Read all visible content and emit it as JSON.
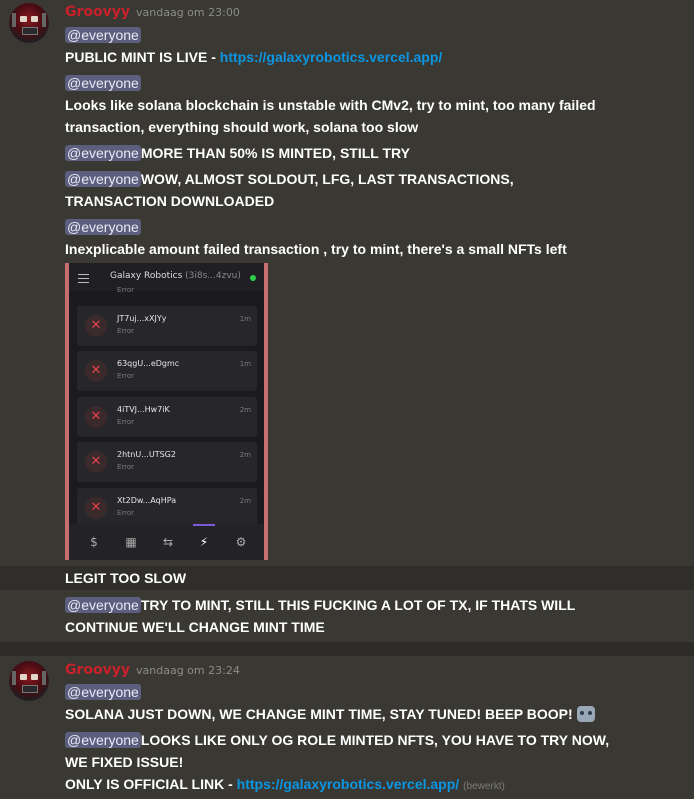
{
  "message1": {
    "username": "Groovyy",
    "timestamp": "vandaag om 23:00",
    "lines": [
      {
        "mention": "@everyone",
        "text": ""
      },
      {
        "text": "PUBLIC MINT IS LIVE - ",
        "link": "https://galaxyrobotics.vercel.app/"
      },
      {
        "mention": "@everyone",
        "text": ""
      },
      {
        "text": "Looks like solana blockchain is unstable with CMv2, try to mint, too many failed"
      },
      {
        "text": "transaction, everything should work, solana too slow"
      },
      {
        "mention": "@everyone",
        "text": "MORE THAN 50% IS MINTED, STILL TRY"
      },
      {
        "mention": "@everyone",
        "text": "WOW, ALMOST SOLDOUT, LFG, LAST TRANSACTIONS,"
      },
      {
        "text": "TRANSACTION DOWNLOADED"
      },
      {
        "mention": "@everyone",
        "text": ""
      },
      {
        "text": "Inexplicable amount failed transaction , try to mint, there's a small NFTs left"
      }
    ],
    "screenshot": {
      "wallet_name": "Galaxy Robotics",
      "wallet_addr": "(3i8s...4zvu)",
      "partial_status": "Error",
      "transactions": [
        {
          "sig": "JT7uj...xXJYy",
          "status": "Error",
          "age": "1m"
        },
        {
          "sig": "63qgU...eDgmc",
          "status": "Error",
          "age": "1m"
        },
        {
          "sig": "4iTVJ...Hw7iK",
          "status": "Error",
          "age": "2m"
        },
        {
          "sig": "2htnU...UTSG2",
          "status": "Error",
          "age": "2m"
        },
        {
          "sig": "Xt2Dw...AqHPa",
          "status": "Error",
          "age": "2m"
        }
      ]
    },
    "after_lines": [
      {
        "text": "LEGIT TOO SLOW"
      },
      {
        "mention": "@everyone",
        "text": "TRY TO MINT, STILL THIS FUCKING A LOT OF TX, IF THATS WILL"
      },
      {
        "text": "CONTINUE WE'LL CHANGE MINT TIME"
      }
    ]
  },
  "message2": {
    "username": "Groovyy",
    "timestamp": "vandaag om 23:24",
    "lines": [
      {
        "mention": "@everyone",
        "text": ""
      },
      {
        "text": "SOLANA JUST DOWN, WE CHANGE MINT TIME, STAY TUNED! BEEP BOOP!"
      },
      {
        "mention": "@everyone",
        "text": "LOOKS LIKE ONLY OG ROLE MINTED NFTS, YOU HAVE TO TRY NOW,"
      },
      {
        "text": "WE FIXED ISSUE!"
      },
      {
        "text": "ONLY IS OFFICIAL LINK - ",
        "link": "https://galaxyrobotics.vercel.app/",
        "edited": "(bewerkt)"
      }
    ]
  },
  "icons": {
    "avatar": "robot-avatar",
    "emoji": "robot-emoji",
    "error": "error-x-icon",
    "nav": [
      "dollar-icon",
      "grid-icon",
      "swap-icon",
      "bolt-icon",
      "gear-icon"
    ]
  },
  "colors": {
    "username": "#c9202a",
    "link": "#0b96e3",
    "mention_bg": "#5b5f7d",
    "background": "#3a3833"
  }
}
